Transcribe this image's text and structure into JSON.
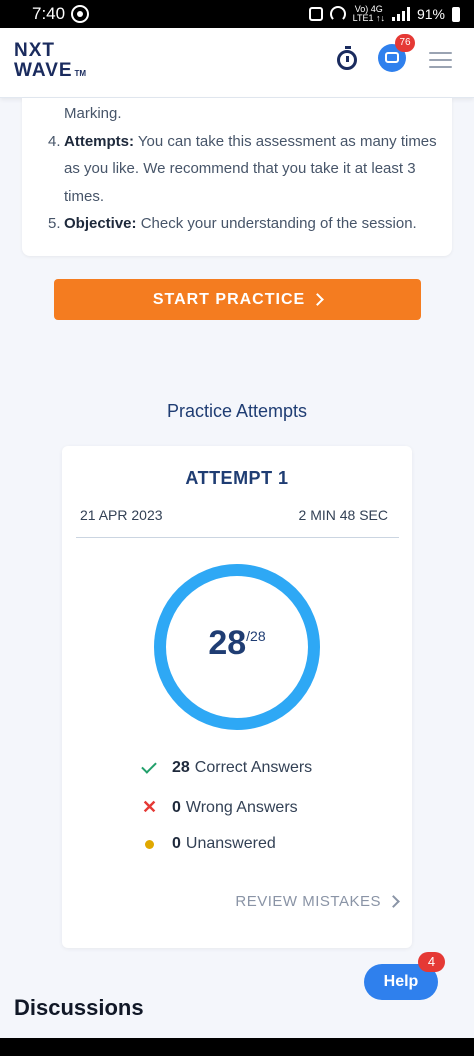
{
  "status_bar": {
    "time": "7:40",
    "lte_top": "Vo) 4G",
    "lte_bottom": "LTE1 ↑↓",
    "battery": "91%"
  },
  "header": {
    "logo_line1": "NXT",
    "logo_line2": "WAVE",
    "logo_tm": "TM",
    "chat_badge": "76"
  },
  "instructions": {
    "line_cont": "Marking.",
    "item4_num": "4.",
    "item4_label": "Attempts:",
    "item4_text_1": " You can take this assessment as many times",
    "item4_text_2": "as you like. We recommend that you take it at least 3",
    "item4_text_3": "times.",
    "item5_num": "5.",
    "item5_label": "Objective:",
    "item5_text": " Check your understanding of the session."
  },
  "start_button": "START PRACTICE",
  "practice_attempts_title": "Practice Attempts",
  "attempt": {
    "title": "ATTEMPT 1",
    "date": "21 APR 2023",
    "duration": "2 MIN 48 SEC",
    "score": "28",
    "total": "/28",
    "score_fraction": 1.0,
    "ring_color": "#2ea8f5",
    "correct_count": "28",
    "correct_label": "Correct Answers",
    "wrong_count": "0",
    "wrong_label": "Wrong Answers",
    "unanswered_count": "0",
    "unanswered_label": "Unanswered",
    "review_link": "REVIEW MISTAKES"
  },
  "help_button": "Help",
  "help_badge": "4",
  "discussions_title": "Discussions",
  "colors": {
    "accent_orange": "#f47c20",
    "primary_blue": "#2f80ed",
    "navy": "#1f3d73"
  }
}
